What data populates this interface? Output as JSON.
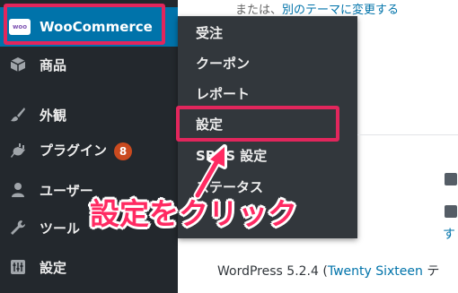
{
  "content_top": {
    "prefix": "または、",
    "link": "別のテーマに変更する"
  },
  "sidebar": {
    "items": [
      {
        "label": "WooCommerce",
        "icon": "woo-logo"
      },
      {
        "label": "商品",
        "icon": "box-icon"
      },
      {
        "label": "外観",
        "icon": "paintbrush-icon"
      },
      {
        "label": "プラグイン",
        "icon": "plugin-icon",
        "badge": "8"
      },
      {
        "label": "ユーザー",
        "icon": "user-icon"
      },
      {
        "label": "ツール",
        "icon": "wrench-icon"
      },
      {
        "label": "設定",
        "icon": "settings-icon"
      }
    ],
    "woo_logo_text": "woo"
  },
  "flyout": {
    "items": [
      {
        "label": "受注"
      },
      {
        "label": "クーポン"
      },
      {
        "label": "レポート"
      },
      {
        "label": "設定"
      },
      {
        "label": "SBPS 設定"
      },
      {
        "label": "ステータス"
      }
    ]
  },
  "right_widget": {
    "link_char": "す"
  },
  "footer": {
    "prefix": "WordPress 5.2.4 (",
    "link": "Twenty Sixteen",
    "suffix": " テ"
  },
  "callout": {
    "text": "設定をクリック"
  },
  "colors": {
    "accent": "#e2265c",
    "sidebar": "#23282d",
    "flyout": "#32373c",
    "woo_bg": "#0073aa",
    "badge": "#ca4a1f"
  }
}
